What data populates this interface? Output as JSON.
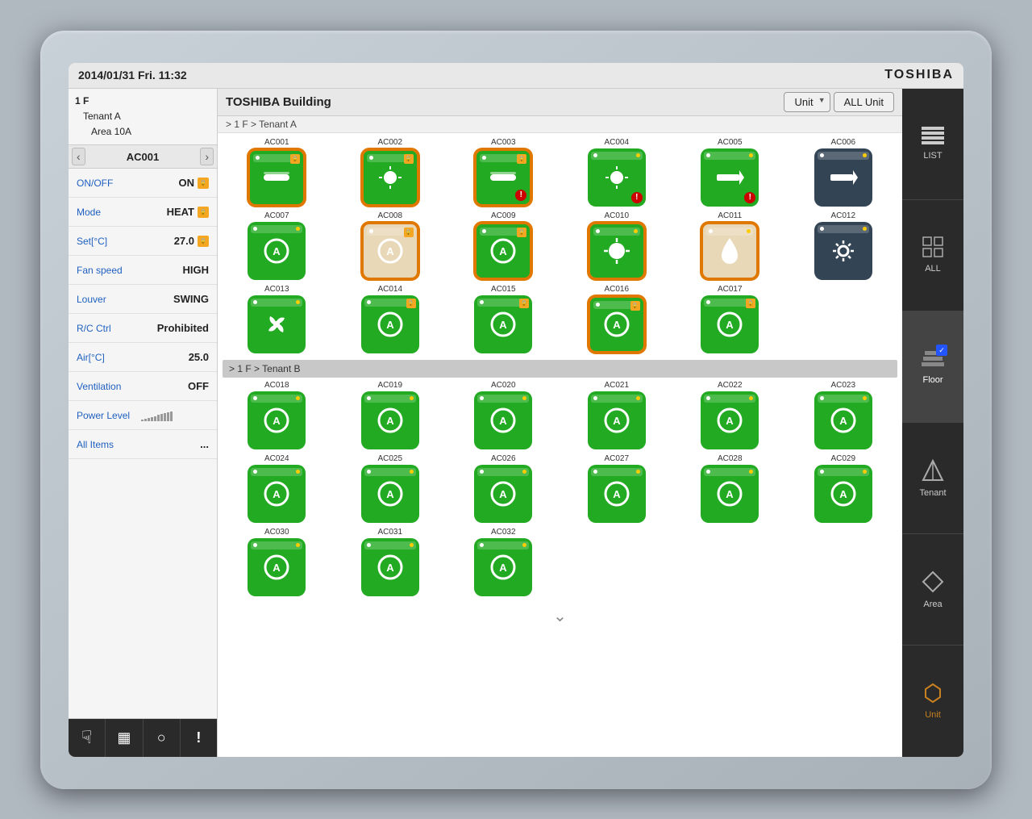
{
  "header": {
    "datetime": "2014/01/31  Fri.  11:32",
    "brand": "TOSHIBA"
  },
  "nav_tree": {
    "floor": "1 F",
    "tenant": "Tenant A",
    "area": "Area 10A",
    "selected_unit": "AC001"
  },
  "controls": [
    {
      "label": "ON/OFF",
      "value": "ON",
      "locked": true
    },
    {
      "label": "Mode",
      "value": "HEAT",
      "locked": true
    },
    {
      "label": "Set[°C]",
      "value": "27.0",
      "locked": true
    },
    {
      "label": "Fan speed",
      "value": "HIGH",
      "locked": false
    },
    {
      "label": "Louver",
      "value": "SWING",
      "locked": false
    },
    {
      "label": "R/C Ctrl",
      "value": "Prohibited",
      "locked": false
    },
    {
      "label": "Air[°C]",
      "value": "25.0",
      "locked": false
    },
    {
      "label": "Ventilation",
      "value": "OFF",
      "locked": false
    },
    {
      "label": "Power Level",
      "value": "",
      "locked": false
    },
    {
      "label": "All Items",
      "value": "...",
      "locked": false
    }
  ],
  "toolbar_buttons": [
    {
      "icon": "☞",
      "label": "hand"
    },
    {
      "icon": "▦",
      "label": "grid"
    },
    {
      "icon": "◌",
      "label": "circle"
    },
    {
      "icon": "!",
      "label": "alert"
    }
  ],
  "center": {
    "building_name": "TOSHIBA Building",
    "unit_button": "Unit",
    "all_unit_button": "ALL Unit",
    "breadcrumb_tenant_a": "> 1 F > Tenant A",
    "breadcrumb_tenant_b": "> 1 F > Tenant B"
  },
  "tenant_a_units": [
    {
      "id": "AC001",
      "selected": true,
      "warn": false,
      "locked": true,
      "style": "normal",
      "icon": "heat"
    },
    {
      "id": "AC002",
      "selected": true,
      "warn": false,
      "locked": true,
      "style": "normal",
      "icon": "sun"
    },
    {
      "id": "AC003",
      "selected": true,
      "warn": true,
      "locked": true,
      "style": "normal",
      "icon": "heat"
    },
    {
      "id": "AC004",
      "selected": false,
      "warn": true,
      "locked": false,
      "style": "normal",
      "icon": "sun"
    },
    {
      "id": "AC005",
      "selected": false,
      "warn": true,
      "locked": false,
      "style": "normal",
      "icon": "arrow"
    },
    {
      "id": "AC006",
      "selected": false,
      "warn": false,
      "locked": false,
      "style": "dark",
      "icon": "arrow"
    },
    {
      "id": "AC007",
      "selected": false,
      "warn": false,
      "locked": false,
      "style": "normal",
      "icon": "auto"
    },
    {
      "id": "AC008",
      "selected": true,
      "warn": false,
      "locked": true,
      "style": "beige",
      "icon": "auto"
    },
    {
      "id": "AC009",
      "selected": true,
      "warn": false,
      "locked": true,
      "style": "normal",
      "icon": "auto"
    },
    {
      "id": "AC010",
      "selected": true,
      "warn": false,
      "locked": false,
      "style": "normal",
      "icon": "sun_big"
    },
    {
      "id": "AC011",
      "selected": true,
      "warn": false,
      "locked": false,
      "style": "beige",
      "icon": "drop"
    },
    {
      "id": "AC012",
      "selected": false,
      "warn": false,
      "locked": false,
      "style": "dark",
      "icon": "gear"
    },
    {
      "id": "AC013",
      "selected": false,
      "warn": false,
      "locked": false,
      "style": "normal",
      "icon": "fan"
    },
    {
      "id": "AC014",
      "selected": false,
      "warn": false,
      "locked": true,
      "style": "normal",
      "icon": "auto"
    },
    {
      "id": "AC015",
      "selected": false,
      "warn": false,
      "locked": true,
      "style": "normal",
      "icon": "auto"
    },
    {
      "id": "AC016",
      "selected": true,
      "warn": false,
      "locked": true,
      "style": "normal",
      "icon": "auto"
    },
    {
      "id": "AC017",
      "selected": false,
      "warn": false,
      "locked": true,
      "style": "normal",
      "icon": "auto"
    }
  ],
  "tenant_b_units": [
    {
      "id": "AC018",
      "selected": false,
      "warn": false,
      "locked": false,
      "style": "normal",
      "icon": "auto"
    },
    {
      "id": "AC019",
      "selected": false,
      "warn": false,
      "locked": false,
      "style": "normal",
      "icon": "auto"
    },
    {
      "id": "AC020",
      "selected": false,
      "warn": false,
      "locked": false,
      "style": "normal",
      "icon": "auto"
    },
    {
      "id": "AC021",
      "selected": false,
      "warn": false,
      "locked": false,
      "style": "normal",
      "icon": "auto"
    },
    {
      "id": "AC022",
      "selected": false,
      "warn": false,
      "locked": false,
      "style": "normal",
      "icon": "auto"
    },
    {
      "id": "AC023",
      "selected": false,
      "warn": false,
      "locked": false,
      "style": "normal",
      "icon": "auto"
    },
    {
      "id": "AC024",
      "selected": false,
      "warn": false,
      "locked": false,
      "style": "normal",
      "icon": "auto"
    },
    {
      "id": "AC025",
      "selected": false,
      "warn": false,
      "locked": false,
      "style": "normal",
      "icon": "auto"
    },
    {
      "id": "AC026",
      "selected": false,
      "warn": false,
      "locked": false,
      "style": "normal",
      "icon": "auto"
    },
    {
      "id": "AC027",
      "selected": false,
      "warn": false,
      "locked": false,
      "style": "normal",
      "icon": "auto"
    },
    {
      "id": "AC028",
      "selected": false,
      "warn": false,
      "locked": false,
      "style": "normal",
      "icon": "auto"
    },
    {
      "id": "AC029",
      "selected": false,
      "warn": false,
      "locked": false,
      "style": "normal",
      "icon": "auto"
    },
    {
      "id": "AC030",
      "selected": false,
      "warn": false,
      "locked": false,
      "style": "normal",
      "icon": "auto"
    },
    {
      "id": "AC031",
      "selected": false,
      "warn": false,
      "locked": false,
      "style": "normal",
      "icon": "auto"
    },
    {
      "id": "AC032",
      "selected": false,
      "warn": false,
      "locked": false,
      "style": "normal",
      "icon": "auto"
    }
  ],
  "right_nav": [
    {
      "id": "list",
      "icon": "⊞",
      "label": "LIST",
      "active": false
    },
    {
      "id": "all",
      "icon": "❖",
      "label": "ALL",
      "active": false
    },
    {
      "id": "floor",
      "icon": "▤",
      "label": "Floor",
      "active": true,
      "checked": true
    },
    {
      "id": "tenant",
      "icon": "◈",
      "label": "Tenant",
      "active": false
    },
    {
      "id": "area",
      "icon": "◇",
      "label": "Area",
      "active": false
    },
    {
      "id": "unit",
      "icon": "◈",
      "label": "Unit",
      "active": false,
      "isunit": true
    }
  ],
  "colors": {
    "green_ac": "#22aa22",
    "orange_border": "#e07800",
    "dark_ac": "#334455",
    "beige_ac": "#e8d8b8",
    "lock_badge": "#f5a623",
    "warn_badge": "#cc0000",
    "right_panel_bg": "#2a2a2a",
    "left_panel_bg": "#f5f5f5",
    "blue_label": "#2060c0"
  }
}
